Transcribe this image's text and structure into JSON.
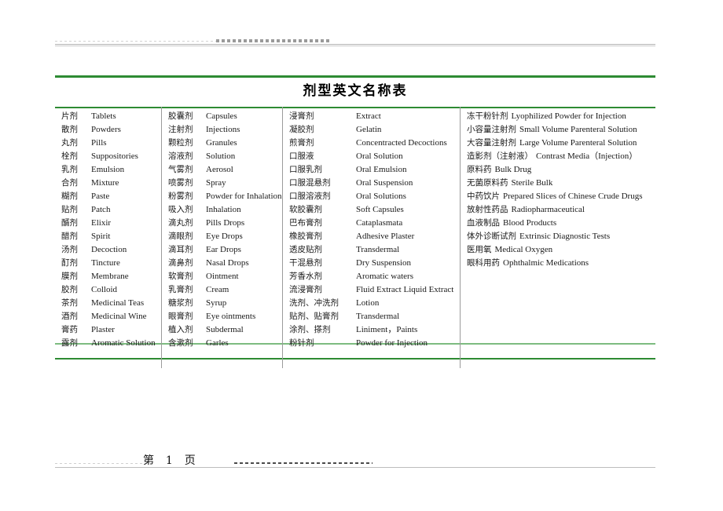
{
  "document": {
    "title": "剂型英文名称表",
    "accent_color": "#2e8b33",
    "rule_color_light": "#7dbb80"
  },
  "header": {
    "rule_label": "header-decorative-rule"
  },
  "footer": {
    "page_label": "第  1  页"
  },
  "table": {
    "columns": [
      {
        "id": "column-1",
        "entries": [
          {
            "cn": "片剂",
            "en": "Tablets"
          },
          {
            "cn": "散剂",
            "en": "Powders"
          },
          {
            "cn": "丸剂",
            "en": "Pills"
          },
          {
            "cn": "栓剂",
            "en": "Suppositories"
          },
          {
            "cn": "乳剂",
            "en": "Emulsion"
          },
          {
            "cn": "合剂",
            "en": "Mixture"
          },
          {
            "cn": "糊剂",
            "en": "Paste"
          },
          {
            "cn": "贴剂",
            "en": "Patch"
          },
          {
            "cn": "醑剂",
            "en": "Elixir"
          },
          {
            "cn": "醋剂",
            "en": "Spirit"
          },
          {
            "cn": "汤剂",
            "en": "Decoction"
          },
          {
            "cn": "酊剂",
            "en": "Tincture"
          },
          {
            "cn": "膜剂",
            "en": "Membrane"
          },
          {
            "cn": "胶剂",
            "en": "Colloid"
          },
          {
            "cn": "茶剂",
            "en": "Medicinal Teas"
          },
          {
            "cn": "酒剂",
            "en": "Medicinal Wine"
          },
          {
            "cn": "膏药",
            "en": "Plaster"
          },
          {
            "cn": "露剂",
            "en": "Aromatic Solution"
          }
        ]
      },
      {
        "id": "column-2",
        "entries": [
          {
            "cn": "胶囊剂",
            "en": "Capsules"
          },
          {
            "cn": "注射剂",
            "en": "Injections"
          },
          {
            "cn": "颗粒剂",
            "en": "Granules"
          },
          {
            "cn": "溶液剂",
            "en": "Solution"
          },
          {
            "cn": "气雾剂",
            "en": "Aerosol"
          },
          {
            "cn": "喷雾剂",
            "en": "Spray"
          },
          {
            "cn": "粉雾剂",
            "en": "Powder for Inhalation"
          },
          {
            "cn": "吸入剂",
            "en": "Inhalation"
          },
          {
            "cn": "滴丸剂",
            "en": "Pills Drops"
          },
          {
            "cn": "滴眼剂",
            "en": "Eye Drops"
          },
          {
            "cn": "滴耳剂",
            "en": "Ear Drops"
          },
          {
            "cn": "滴鼻剂",
            "en": "Nasal Drops"
          },
          {
            "cn": "软膏剂",
            "en": "Ointment"
          },
          {
            "cn": "乳膏剂",
            "en": "Cream"
          },
          {
            "cn": "糖浆剂",
            "en": "Syrup"
          },
          {
            "cn": "眼膏剂",
            "en": "Eye ointments"
          },
          {
            "cn": "植入剂",
            "en": "Subdermal"
          },
          {
            "cn": "含漱剂",
            "en": "Garles"
          }
        ]
      },
      {
        "id": "column-3",
        "entries": [
          {
            "cn": "浸膏剂",
            "en": "Extract"
          },
          {
            "cn": "凝胶剂",
            "en": "Gelatin"
          },
          {
            "cn": "煎膏剂",
            "en": "Concentracted Decoctions"
          },
          {
            "cn": "口服液",
            "en": "Oral Solution"
          },
          {
            "cn": "口服乳剂",
            "en": "Oral Emulsion"
          },
          {
            "cn": "口服混悬剂",
            "en": "Oral Suspension"
          },
          {
            "cn": "口服溶液剂",
            "en": "Oral Solutions"
          },
          {
            "cn": "软胶囊剂",
            "en": "Soft Capsules"
          },
          {
            "cn": "巴布膏剂",
            "en": "Cataplasmata"
          },
          {
            "cn": "橡胶膏剂",
            "en": "Adhesive Plaster"
          },
          {
            "cn": "透皮贴剂",
            "en": "Transdermal"
          },
          {
            "cn": "干混悬剂",
            "en": "Dry Suspension"
          },
          {
            "cn": "芳香水剂",
            "en": "Aromatic waters"
          },
          {
            "cn": "流浸膏剂",
            "en": "Fluid Extract Liquid Extract"
          },
          {
            "cn": "洗剂、冲洗剂",
            "en": "Lotion"
          },
          {
            "cn": "贴剂、贴膏剂",
            "en": "Transdermal"
          },
          {
            "cn": "涂剂、搽剂",
            "en": "Liniment，Paints"
          },
          {
            "cn": "粉针剂",
            "en": "Powder for Injection"
          }
        ]
      },
      {
        "id": "column-4",
        "entries": [
          {
            "cn": "冻干粉针剂",
            "en": "Lyophilized Powder for Injection"
          },
          {
            "cn": "小容量注射剂",
            "en": "Small Volume Parenteral Solution"
          },
          {
            "cn": "大容量注射剂",
            "en": "Large Volume Parenteral Solution"
          },
          {
            "cn": "造影剂（注射液）",
            "en": "Contrast Media（Injection）"
          },
          {
            "cn": "原料药",
            "en": "Bulk Drug"
          },
          {
            "cn": "无菌原料药",
            "en": "Sterile Bulk"
          },
          {
            "cn": "中药饮片",
            "en": "Prepared Slices of Chinese Crude Drugs"
          },
          {
            "cn": "放射性药品",
            "en": "Radiopharmaceutical"
          },
          {
            "cn": "血液制品",
            "en": "Blood Products"
          },
          {
            "cn": "体外诊断试剂",
            "en": "Extrinsic Diagnostic Tests"
          },
          {
            "cn": "医用氧",
            "en": "Medical Oxygen"
          },
          {
            "cn": "眼科用药",
            "en": "Ophthalmic Medications"
          }
        ]
      }
    ]
  }
}
